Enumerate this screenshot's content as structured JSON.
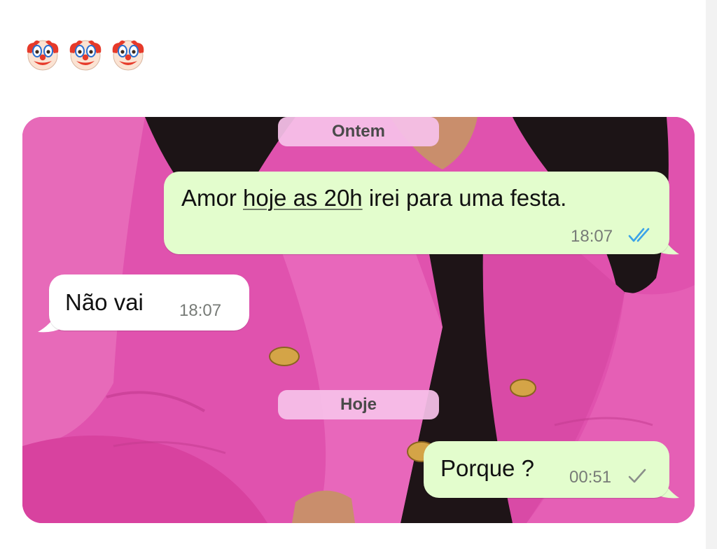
{
  "post": {
    "emoji": [
      "clown-face",
      "clown-face",
      "clown-face"
    ]
  },
  "chat": {
    "days": {
      "yesterday": "Ontem",
      "today": "Hoje"
    },
    "messages": [
      {
        "direction": "outgoing",
        "text_before": "Amor ",
        "text_link": "hoje as 20h",
        "text_after": " irei para uma festa.",
        "time": "18:07",
        "status": "read"
      },
      {
        "direction": "incoming",
        "text": "Não vai",
        "time": "18:07"
      },
      {
        "direction": "outgoing",
        "text": "Porque ?",
        "time": "00:51",
        "status": "sent"
      }
    ],
    "colors": {
      "background_blazer": "#e052ae",
      "outgoing_bubble": "#e3fdcd",
      "incoming_bubble": "#ffffff",
      "read_check": "#3ba3e8",
      "sent_check": "#8a8f8a"
    }
  }
}
